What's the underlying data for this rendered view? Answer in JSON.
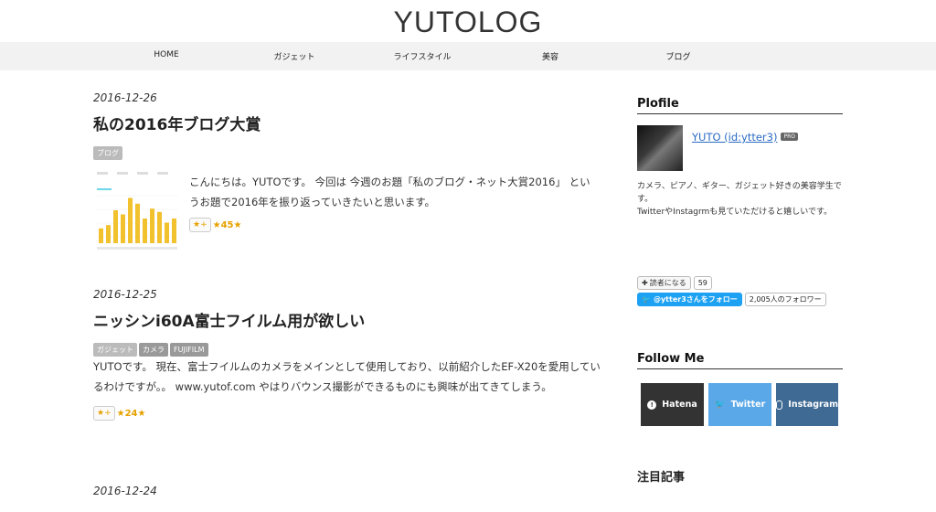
{
  "site": {
    "title": "YUTOLOG"
  },
  "nav": [
    "HOME",
    "ガジェット",
    "ライフスタイル",
    "美容",
    "ブログ"
  ],
  "entries": [
    {
      "date": "2016-12-26",
      "title": "私の2016年ブログ大賞",
      "categories": [
        "ブログ"
      ],
      "excerpt": "こんにちは。YUTOです。 今回は 今週のお題「私のブログ・ネット大賞2016」 というお題で2016年を振り返っていきたいと思います。",
      "star_button": "★+",
      "star_count": "★45★"
    },
    {
      "date": "2016-12-25",
      "title": "ニッシンi60A富士フイルム用が欲しい",
      "categories": [
        "ガジェット",
        "カメラ",
        "FUJIFILM"
      ],
      "excerpt": "YUTOです。 現在、富士フイルムのカメラをメインとして使用しており、以前紹介したEF-X20を愛用しているわけですが。。 www.yutof.com やはりバウンス撮影ができるものにも興味が出てきてしまう。",
      "star_button": "★+",
      "star_count": "★24★"
    },
    {
      "date": "2016-12-24"
    }
  ],
  "thumb_chart": {
    "values": [
      18,
      22,
      40,
      35,
      55,
      48,
      30,
      42,
      38,
      25,
      30
    ],
    "bar_color": "#f2c12e",
    "line_color": "#6bd7e8"
  },
  "sidebar": {
    "profile": {
      "heading": "Plofile",
      "name": "YUTO (id:ytter3)",
      "badge": "PRO",
      "desc1": "カメラ、ピアノ、ギター、ガジェット好きの美容学生です。",
      "desc2": "TwitterやInstagrmも見ていただけると嬉しいです。"
    },
    "reader_button": "読者になる",
    "reader_count": "59",
    "twitter_follow": "@ytter3さんをフォロー",
    "twitter_count": "2,005人のフォロワー",
    "follow_heading": "Follow Me",
    "follow_buttons": [
      {
        "label": "Hatena",
        "color": "#333333",
        "icon": "hatena-icon"
      },
      {
        "label": "Twitter",
        "color": "#5aa8e8",
        "icon": "twitter-icon"
      },
      {
        "label": "Instagram",
        "color": "#3f6a93",
        "icon": "instagram-icon"
      }
    ],
    "featured_heading": "注目記事"
  }
}
